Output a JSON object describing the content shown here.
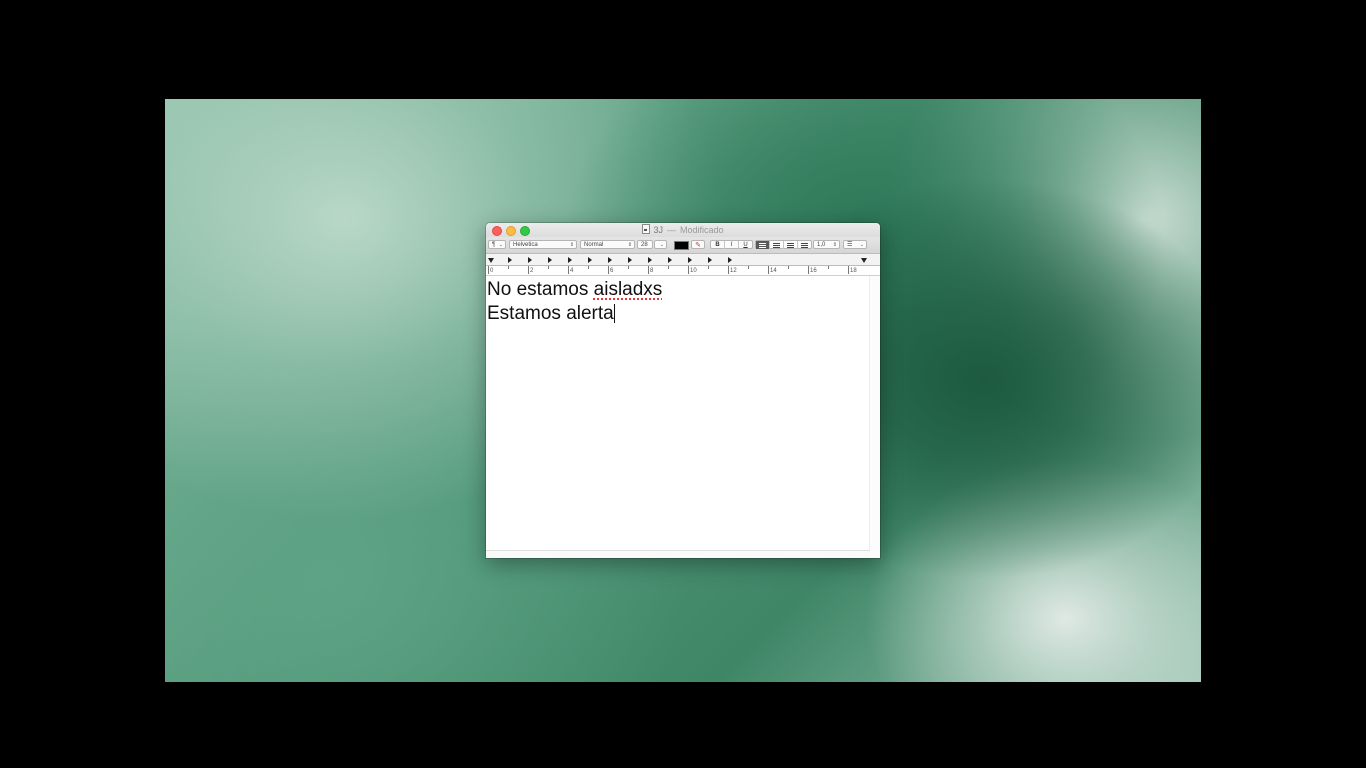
{
  "window": {
    "title": "3J",
    "title_separator": "—",
    "status": "Modificado"
  },
  "toolbar": {
    "paragraph_style": "¶",
    "font_family": "Helvetica",
    "font_style": "Normal",
    "font_size": "28",
    "text_color": "#000000",
    "bold": "B",
    "italic": "I",
    "underline": "U",
    "alignment_selected": "left",
    "line_spacing": "1,0",
    "list_style": "☰"
  },
  "ruler": {
    "labels": [
      "0",
      "2",
      "4",
      "6",
      "8",
      "10",
      "12",
      "14",
      "16",
      "18"
    ]
  },
  "document": {
    "line1_start": "No estamos ",
    "line1_misspelled": "aisladxs",
    "line2": "Estamos alerta"
  }
}
